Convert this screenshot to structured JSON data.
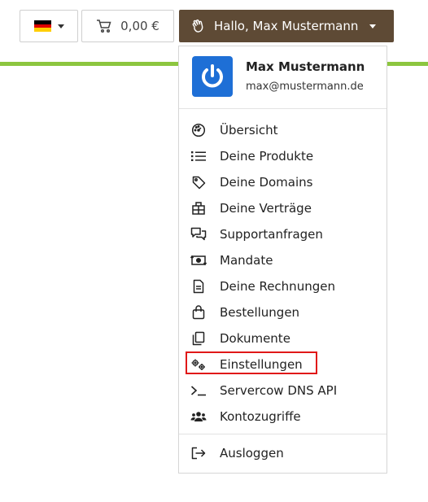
{
  "topbar": {
    "cart_total": "0,00 €",
    "user_greeting": "Hallo, Max Mustermann",
    "accent_color": "#8cc63f",
    "user_button_color": "#5e4a35"
  },
  "profile": {
    "name": "Max Mustermann",
    "email": "max@mustermann.de",
    "avatar_color": "#1e6fd6"
  },
  "menu": {
    "items": [
      {
        "label": "Übersicht",
        "icon": "dashboard-icon"
      },
      {
        "label": "Deine Produkte",
        "icon": "list-icon"
      },
      {
        "label": "Deine Domains",
        "icon": "tag-icon"
      },
      {
        "label": "Deine Verträge",
        "icon": "contract-icon"
      },
      {
        "label": "Supportanfragen",
        "icon": "chat-icon"
      },
      {
        "label": "Mandate",
        "icon": "money-transfer-icon"
      },
      {
        "label": "Deine Rechnungen",
        "icon": "invoice-icon"
      },
      {
        "label": "Bestellungen",
        "icon": "shopping-bag-icon"
      },
      {
        "label": "Dokumente",
        "icon": "documents-icon"
      },
      {
        "label": "Einstellungen",
        "icon": "gears-icon",
        "highlighted": true
      },
      {
        "label": "Servercow DNS API",
        "icon": "terminal-icon"
      },
      {
        "label": "Kontozugriffe",
        "icon": "users-icon"
      }
    ],
    "logout_label": "Ausloggen"
  }
}
